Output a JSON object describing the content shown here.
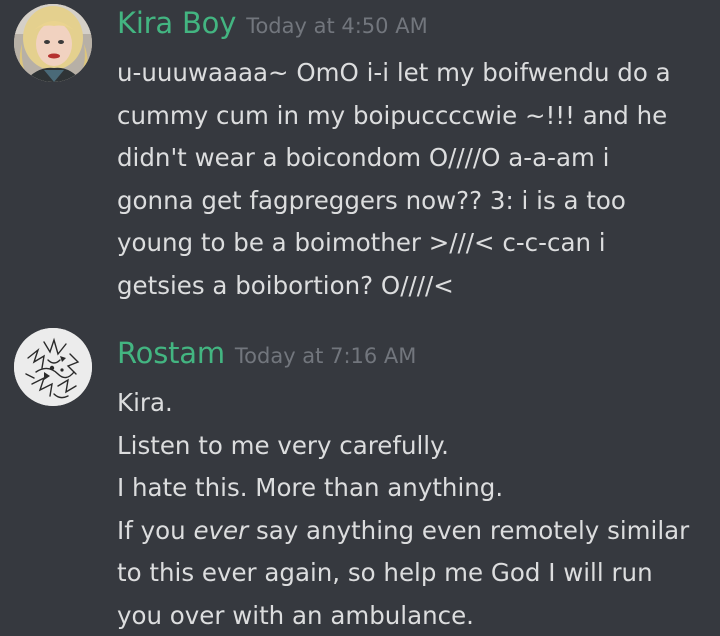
{
  "colors": {
    "background": "#36393f",
    "username": "#43b581",
    "timestamp": "#72767d",
    "text": "#dcddde"
  },
  "messages": [
    {
      "username": "Kira Boy",
      "timestamp": "Today at 4:50 AM",
      "avatar_icon": "user-avatar-blonde-woman",
      "lines": [
        "u-uuuwaaaa~ OmO i-i let my boifwendu do a",
        "cummy cum in my boipuccccwie ~!!! and he",
        "didn't wear a boicondom O////O a-a-am i",
        "gonna get fagpreggers now?? 3: i is a too",
        "young to be a boimother >///< c-c-can i",
        "getsies a boibortion? O////<"
      ]
    },
    {
      "username": "Rostam",
      "timestamp": "Today at 7:16 AM",
      "avatar_icon": "user-avatar-sketch-drawing",
      "lines": [
        "Kira.",
        "Listen to me very carefully.",
        "I hate this. More than anything."
      ],
      "line4": {
        "before": "If you ",
        "emphasis": "ever",
        "after": " say anything even remotely similar"
      },
      "lines_end": [
        "to this ever again, so help me God I will run",
        "you over with an ambulance."
      ]
    }
  ]
}
